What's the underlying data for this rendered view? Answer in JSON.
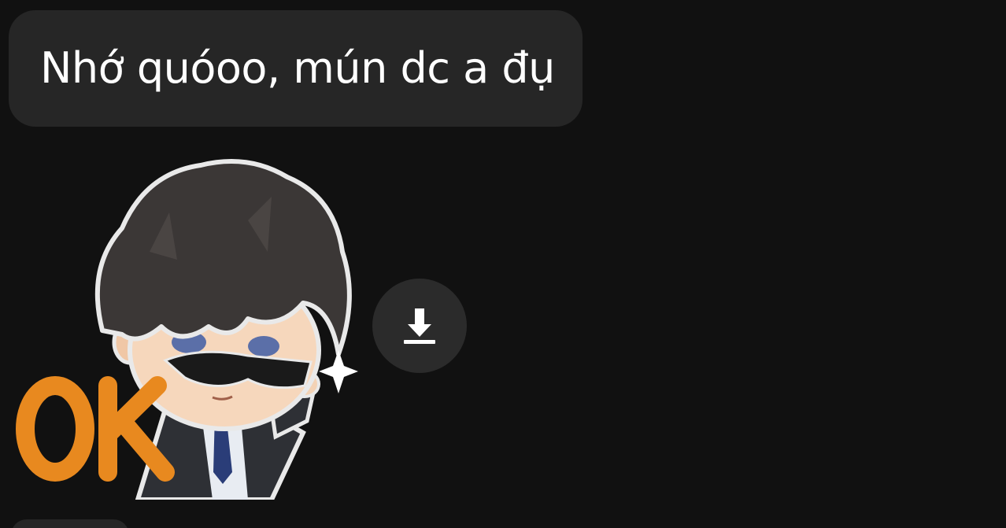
{
  "conversation": {
    "message_text": "Nhớ quóoo, mún dc a đụ",
    "sticker": {
      "caption": "OK",
      "icon": "chibi-boy-sunglasses-sticker"
    },
    "save_sticker_icon": "download-icon"
  },
  "colors": {
    "background": "#111111",
    "bubble": "#262626",
    "button": "#2b2b2b",
    "text": "#ffffff",
    "sticker_accent": "#e8891f"
  }
}
